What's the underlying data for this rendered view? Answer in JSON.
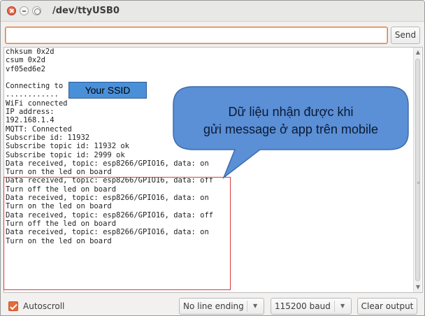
{
  "window": {
    "title": "/dev/ttyUSB0"
  },
  "send_bar": {
    "input_value": "",
    "send_label": "Send"
  },
  "console": {
    "lines": [
      "chksum 0x2d",
      "csum 0x2d",
      "vf05ed6e2",
      "",
      "Connecting to",
      "............",
      "WiFi connected",
      "IP address:",
      "192.168.1.4",
      "MQTT: Connected",
      "Subscribe id: 11932",
      "Subscribe topic id: 11932 ok",
      "Subscribe topic id: 2999 ok",
      "Data received, topic: esp8266/GPIO16, data: on",
      "Turn on the led on board",
      "Data received, topic: esp8266/GPIO16, data: off",
      "Turn off the led on board",
      "Data received, topic: esp8266/GPIO16, data: on",
      "Turn on the led on board",
      "Data received, topic: esp8266/GPIO16, data: off",
      "Turn off the led on board",
      "Data received, topic: esp8266/GPIO16, data: on",
      "Turn on the led on board"
    ]
  },
  "annotations": {
    "ssid_label": "Your SSID",
    "callout_line1": "Dữ liệu nhận được khi",
    "callout_line2": "gửi message ở app trên mobile",
    "callout_color": "#5b8fd6",
    "highlight_color": "#d9393d"
  },
  "bottom_bar": {
    "autoscroll_label": "Autoscroll",
    "autoscroll_checked": true,
    "line_ending": "No line ending",
    "baud_rate": "115200 baud",
    "clear_label": "Clear output"
  },
  "colors": {
    "accent": "#e66a3a",
    "background": "#f2f1f0"
  }
}
